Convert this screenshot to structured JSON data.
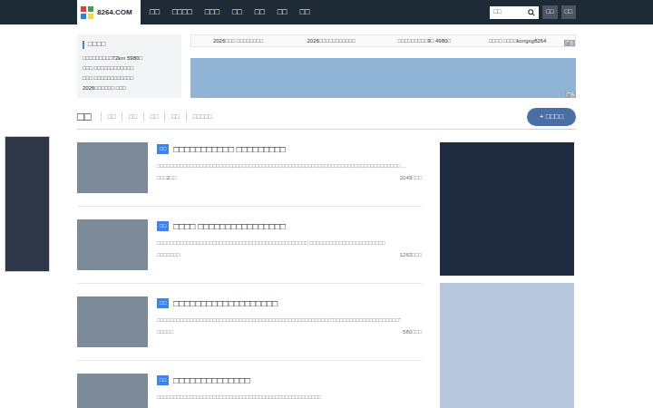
{
  "header": {
    "logo": "8264.COM",
    "nav": [
      "□□",
      "□□□□",
      "□□□",
      "□□",
      "□□",
      "□□",
      "□□"
    ],
    "search": {
      "value": "□□"
    },
    "buttons": [
      "□□",
      "□□"
    ]
  },
  "left_box": {
    "title": "□□□□",
    "items": [
      "□□□□□□□□□72km 5980□",
      "□□□ □□□□□□□□□□□□",
      "□□□ □□□□□□□□□□□□",
      "2026□□□□□□ □□□"
    ]
  },
  "tickers": [
    "2026□□□ □□□□□□□□",
    "2026□□□□□□□□□□□",
    "□□□□□□□□□9□ 4980□",
    "□□□□ □□□□kongxg8264"
  ],
  "ad_label": "广告",
  "tabs": [
    {
      "label": "□□",
      "selected": true
    },
    {
      "label": "□□",
      "selected": false
    },
    {
      "label": "□□",
      "selected": false
    },
    {
      "label": "□□",
      "selected": false
    },
    {
      "label": "□□",
      "selected": false
    },
    {
      "label": "□□□□□",
      "selected": false
    }
  ],
  "post_button": "+ □□□□",
  "articles": [
    {
      "badge": "□□",
      "title": "□□□□□□□□□□□ □□□□□□□□□",
      "excerpt": "□□□□□□□□□□□□□□□□□□□□□□□□□□□□□□□□□□□□□□□□□□□□□□□□□□□□□□□□□□□□□□□□□□□□□□□□□□ ...",
      "author": "□□□2□□",
      "views": "2049□□□"
    },
    {
      "badge": "□□",
      "title": "□□□□ □□□□□□□□□□□□□□□□",
      "excerpt": "□□□□□□□□□□□□□□□□□□□□□□□□□□□□□□□□□□□□□□□□□□□□□□ □□□□□□□□□□□□□□□□□□□□□□□",
      "author": "□□□□□□□",
      "views": "1263□□□"
    },
    {
      "badge": "□□",
      "title": "□□□□□□□□□□□□□□□□□□□",
      "excerpt": "□□□□□□□□□□□□□□□□□□□□□□□□□□□□□□□□□□□□□□□□□□□□□□□□□□□□□“□□□□□□□□□□□□□□□□□□□□”",
      "author": "□□□□□",
      "views": "580□□□"
    },
    {
      "badge": "□□",
      "title": "□□□□□□□□□□□□□□",
      "excerpt": "□□□□□□□□□□□□□□□□□□□□□□□□□□□□□□□□□□□□□□□□□□□□□□□□□□",
      "author": "",
      "views": ""
    }
  ]
}
